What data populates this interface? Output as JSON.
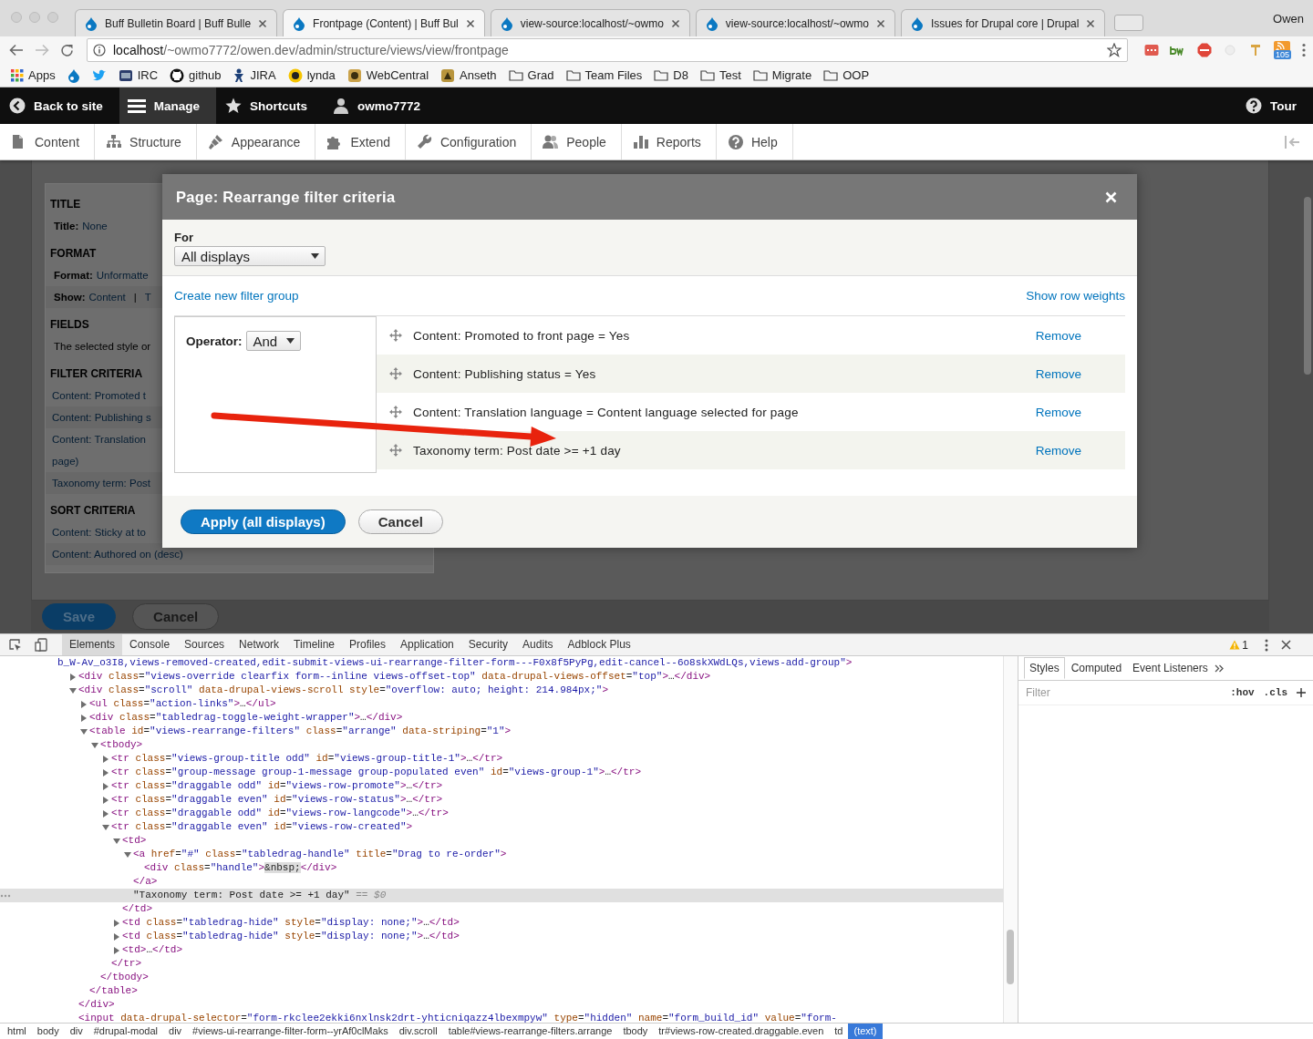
{
  "browser": {
    "tabs": [
      {
        "title": "Buff Bulletin Board | Buff Bulle",
        "selected": false
      },
      {
        "title": "Frontpage (Content) | Buff Bul",
        "selected": true
      },
      {
        "title": "view-source:localhost/~owmo",
        "selected": false
      },
      {
        "title": "view-source:localhost/~owmo",
        "selected": false
      },
      {
        "title": "Issues for Drupal core | Drupal",
        "selected": false
      }
    ],
    "profile": "Owen",
    "address": {
      "host": "localhost",
      "path": "/~owmo7772/owen.dev/admin/structure/views/view/frontpage"
    },
    "extension_badge": "105",
    "bookmarks": [
      {
        "kind": "apps",
        "label": "Apps"
      },
      {
        "kind": "icon"
      },
      {
        "kind": "icon"
      },
      {
        "kind": "site",
        "label": "IRC"
      },
      {
        "kind": "site",
        "label": "github"
      },
      {
        "kind": "site",
        "label": "JIRA"
      },
      {
        "kind": "site",
        "label": "lynda"
      },
      {
        "kind": "site",
        "label": "WebCentral"
      },
      {
        "kind": "site",
        "label": "Anseth"
      },
      {
        "kind": "folder",
        "label": "Grad"
      },
      {
        "kind": "folder",
        "label": "Team Files"
      },
      {
        "kind": "folder",
        "label": "D8"
      },
      {
        "kind": "folder",
        "label": "Test"
      },
      {
        "kind": "folder",
        "label": "Migrate"
      },
      {
        "kind": "folder",
        "label": "OOP"
      }
    ]
  },
  "toolbar": {
    "items": [
      {
        "label": "Back to site",
        "selected": false
      },
      {
        "label": "Manage",
        "selected": true
      },
      {
        "label": "Shortcuts",
        "selected": false
      },
      {
        "label": "owmo7772",
        "selected": false
      }
    ],
    "tour": "Tour",
    "tray": [
      "Content",
      "Structure",
      "Appearance",
      "Extend",
      "Configuration",
      "People",
      "Reports",
      "Help"
    ]
  },
  "page": {
    "sections": [
      {
        "heading": "TITLE",
        "rows": [
          {
            "kind": "pair",
            "label": "Title:",
            "value": "None"
          }
        ]
      },
      {
        "heading": "FORMAT",
        "rows": [
          {
            "kind": "pair",
            "label": "Format:",
            "value": "Unformatte"
          },
          {
            "kind": "show",
            "label": "Show:",
            "value": "Content",
            "separator": "|",
            "extra": "T"
          }
        ]
      },
      {
        "heading": "FIELDS",
        "rows": [
          {
            "kind": "text",
            "lines": [
              "The selected style or"
            ]
          }
        ]
      },
      {
        "heading": "FILTER CRITERIA",
        "rows": [
          {
            "kind": "link",
            "lines": [
              "Content: Promoted t"
            ]
          },
          {
            "kind": "link",
            "lines": [
              "Content: Publishing s"
            ]
          },
          {
            "kind": "link",
            "lines": [
              "Content: Translation",
              "page)"
            ]
          },
          {
            "kind": "link",
            "lines": [
              "Taxonomy term: Post"
            ]
          }
        ]
      },
      {
        "heading": "SORT CRITERIA",
        "rows": [
          {
            "kind": "link",
            "lines": [
              "Content: Sticky at to"
            ]
          },
          {
            "kind": "link",
            "lines": [
              "Content: Authored on (desc)"
            ]
          }
        ]
      }
    ],
    "save": "Save",
    "cancel": "Cancel"
  },
  "modal": {
    "title": "Page: Rearrange filter criteria",
    "for_label": "For",
    "for_value": "All displays",
    "create_link": "Create new filter group",
    "weights_link": "Show row weights",
    "operator_label": "Operator:",
    "operator_value": "And",
    "rows": [
      {
        "text": "Content: Promoted to front page = Yes",
        "action": "Remove"
      },
      {
        "text": "Content: Publishing status = Yes",
        "action": "Remove"
      },
      {
        "text": "Content: Translation language = Content language selected for page",
        "action": "Remove"
      },
      {
        "text": "Taxonomy term: Post date >= +1 day",
        "action": "Remove"
      }
    ],
    "apply": "Apply (all displays)",
    "cancel": "Cancel"
  },
  "devtools": {
    "tabs": [
      {
        "label": "Elements",
        "selected": true
      },
      {
        "label": "Console",
        "selected": false
      },
      {
        "label": "Sources",
        "selected": false
      },
      {
        "label": "Network",
        "selected": false
      },
      {
        "label": "Timeline",
        "selected": false
      },
      {
        "label": "Profiles",
        "selected": false
      },
      {
        "label": "Application",
        "selected": false
      },
      {
        "label": "Security",
        "selected": false
      },
      {
        "label": "Audits",
        "selected": false
      },
      {
        "label": "Adblock Plus",
        "selected": false
      }
    ],
    "warning_count": "1",
    "dom_tree": [
      {
        "kind": "continuation",
        "code": "b_W-Av_o3I8,views-removed-created,edit-submit-views-ui-rearrange-filter-form---F0x8f5PyPg,edit-cancel--6o8skXWdLQs,views-add-group\">",
        "selected": false
      },
      {
        "kind": "element",
        "code": "<div class=\"views-override clearfix form--inline views-offset-top\" data-drupal-views-offset=\"top\">…</div>",
        "expanded": false,
        "selected": false
      },
      {
        "kind": "element",
        "code": "<div class=\"scroll\" data-drupal-views-scroll style=\"overflow: auto; height: 214.984px;\">",
        "expanded": true,
        "selected": false,
        "closing": "</div>",
        "children": [
          {
            "kind": "element",
            "code": "<ul class=\"action-links\">…</ul>",
            "expanded": false,
            "selected": false
          },
          {
            "kind": "element",
            "code": "<div class=\"tabledrag-toggle-weight-wrapper\">…</div>",
            "expanded": false,
            "selected": false
          },
          {
            "kind": "element",
            "code": "<table id=\"views-rearrange-filters\" class=\"arrange\" data-striping=\"1\">",
            "expanded": true,
            "selected": false,
            "closing": "</table>",
            "children": [
              {
                "kind": "element",
                "code": "<tbody>",
                "expanded": true,
                "selected": false,
                "closing": "</tbody>",
                "children": [
                  {
                    "kind": "element",
                    "code": "<tr class=\"views-group-title odd\" id=\"views-group-title-1\">…</tr>",
                    "expanded": false,
                    "selected": false
                  },
                  {
                    "kind": "element",
                    "code": "<tr class=\"group-message group-1-message group-populated even\" id=\"views-group-1\">…</tr>",
                    "expanded": false,
                    "selected": false
                  },
                  {
                    "kind": "element",
                    "code": "<tr class=\"draggable odd\" id=\"views-row-promote\">…</tr>",
                    "expanded": false,
                    "selected": false
                  },
                  {
                    "kind": "element",
                    "code": "<tr class=\"draggable even\" id=\"views-row-status\">…</tr>",
                    "expanded": false,
                    "selected": false
                  },
                  {
                    "kind": "element",
                    "code": "<tr class=\"draggable odd\" id=\"views-row-langcode\">…</tr>",
                    "expanded": false,
                    "selected": false
                  },
                  {
                    "kind": "element",
                    "code": "<tr class=\"draggable even\" id=\"views-row-created\">",
                    "expanded": true,
                    "selected": false,
                    "closing": "</tr>",
                    "children": [
                      {
                        "kind": "element",
                        "code": "<td>",
                        "expanded": true,
                        "selected": false,
                        "closing": "</td>",
                        "children": [
                          {
                            "kind": "element",
                            "code": "<a href=\"#\" class=\"tabledrag-handle\" title=\"Drag to re-order\">",
                            "expanded": true,
                            "selected": false,
                            "closing": "</a>",
                            "children": [
                              {
                                "kind": "element",
                                "code": "<div class=\"handle\">&nbsp;</div>",
                                "selected": false
                              }
                            ]
                          },
                          {
                            "kind": "text",
                            "code": "\"Taxonomy term: Post date >= +1 day\"",
                            "console_ref": "== $0",
                            "selected": true
                          }
                        ]
                      },
                      {
                        "kind": "element",
                        "code": "<td class=\"tabledrag-hide\" style=\"display: none;\">…</td>",
                        "expanded": false,
                        "selected": false
                      },
                      {
                        "kind": "element",
                        "code": "<td class=\"tabledrag-hide\" style=\"display: none;\">…</td>",
                        "expanded": false,
                        "selected": false
                      },
                      {
                        "kind": "element",
                        "code": "<td>…</td>",
                        "expanded": false,
                        "selected": false
                      }
                    ]
                  }
                ]
              }
            ]
          }
        ]
      },
      {
        "kind": "element",
        "code": "<input data-drupal-selector=\"form-rkclee2ekki6nxlnsk2drt-yhticniqazz4lbexmpyw\" type=\"hidden\" name=\"form_build_id\" value=\"form-",
        "selected": false
      }
    ],
    "side_tabs": [
      {
        "label": "Styles",
        "selected": true
      },
      {
        "label": "Computed",
        "selected": false
      },
      {
        "label": "Event Listeners",
        "selected": false
      }
    ],
    "filter": {
      "placeholder": "Filter"
    },
    "hov": ":hov",
    "cls": ".cls",
    "breadcrumb": [
      {
        "label": "html",
        "selected": false
      },
      {
        "label": "body",
        "selected": false
      },
      {
        "label": "div",
        "selected": false
      },
      {
        "label": "#drupal-modal",
        "selected": false
      },
      {
        "label": "div",
        "selected": false
      },
      {
        "label": "#views-ui-rearrange-filter-form--yrAf0clMaks",
        "selected": false
      },
      {
        "label": "div.scroll",
        "selected": false
      },
      {
        "label": "table#views-rearrange-filters.arrange",
        "selected": false
      },
      {
        "label": "tbody",
        "selected": false
      },
      {
        "label": "tr#views-row-created.draggable.even",
        "selected": false
      },
      {
        "label": "td",
        "selected": false
      },
      {
        "label": "(text)",
        "selected": true
      }
    ]
  }
}
